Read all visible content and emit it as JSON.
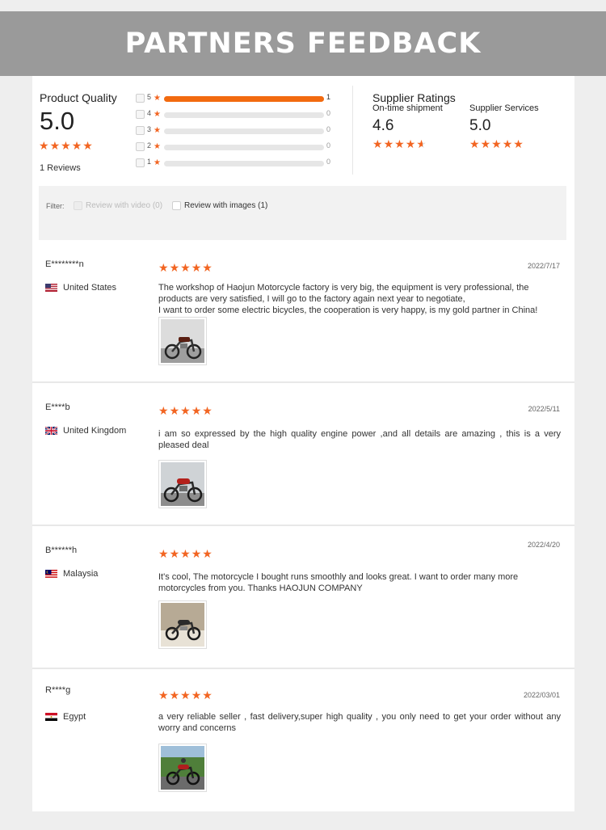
{
  "banner": {
    "title": "PARTNERS FEEDBACK"
  },
  "product_quality": {
    "title": "Product Quality",
    "score": "5.0",
    "stars": 5,
    "reviews_label": "1 Reviews",
    "distribution": [
      {
        "star": "5",
        "count": "1",
        "fraction": 1.0
      },
      {
        "star": "4",
        "count": "0",
        "fraction": 0
      },
      {
        "star": "3",
        "count": "0",
        "fraction": 0
      },
      {
        "star": "2",
        "count": "0",
        "fraction": 0
      },
      {
        "star": "1",
        "count": "0",
        "fraction": 0
      }
    ]
  },
  "supplier_ratings": {
    "title": "Supplier Ratings",
    "ontime": {
      "label": "On-time shipment",
      "value": "4.6",
      "stars": 4.6
    },
    "services": {
      "label": "Supplier Services",
      "value": "5.0",
      "stars": 5
    }
  },
  "filter": {
    "label": "Filter:",
    "video_option": "Review with video (0)",
    "images_option": "Review with images (1)"
  },
  "reviews": [
    {
      "user": "E********n",
      "country": "United States",
      "flag": "us-flag",
      "stars": 5,
      "date": "2022/7/17",
      "text": "The workshop of Haojun Motorcycle factory is very big, the equipment is very professional, the products are very satisfied, I will go to the factory again next year to negotiate,\nI want to order some electric bicycles, the cooperation is very happy, is my gold partner in China!"
    },
    {
      "user": "E****b",
      "country": "United Kingdom",
      "flag": "uk-flag",
      "stars": 5,
      "date": "2022/5/11",
      "text": "i am so expressed by the high quality engine power ,and all details are amazing , this is a very  pleased deal"
    },
    {
      "user": "B******h",
      "country": "Malaysia",
      "flag": "malaysia-flag",
      "stars": 5,
      "date": "2022/4/20",
      "text": "It's cool, The motorcycle I bought runs smoothly and looks great. I want to order many more motorcycles from you. Thanks HAOJUN COMPANY"
    },
    {
      "user": "R****g",
      "country": "Egypt",
      "flag": "egypt-flag",
      "stars": 5,
      "date": "2022/03/01",
      "text": "a very reliable seller , fast delivery,super high quality , you only need  to  get  your  order without any  worry and  concerns"
    }
  ],
  "colors": {
    "accent": "#f26522",
    "banner": "#9a9a9a"
  }
}
